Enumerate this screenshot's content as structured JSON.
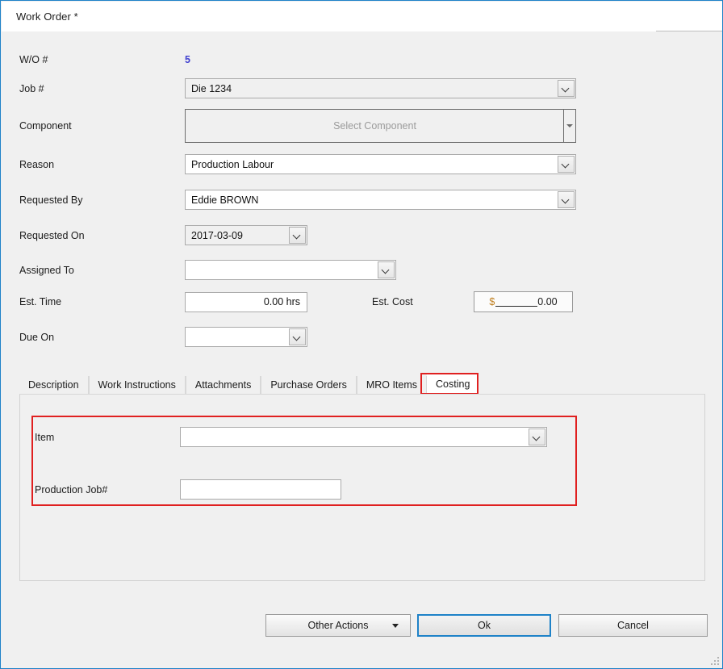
{
  "window": {
    "title": "Work Order *",
    "accent_color": "#1e82c8",
    "highlight_color": "#e02020"
  },
  "form": {
    "fields": [
      {
        "label": "W/O #",
        "type": "static",
        "value": "5"
      },
      {
        "label": "Job #",
        "type": "combo",
        "value": "Die 1234"
      },
      {
        "label": "Component",
        "type": "picker",
        "value": "",
        "placeholder": "Select Component"
      },
      {
        "label": "Reason",
        "type": "combo",
        "value": "Production Labour"
      },
      {
        "label": "Requested By",
        "type": "combo",
        "value": "Eddie BROWN"
      },
      {
        "label": "Requested On",
        "type": "datecombo",
        "value": "2017-03-09"
      },
      {
        "label": "Assigned To",
        "type": "combo",
        "value": ""
      },
      {
        "label": "Est. Time",
        "type": "textbox",
        "value": "0.00 hrs"
      },
      {
        "label": "Due On",
        "type": "datecombo",
        "value": ""
      }
    ],
    "est_cost": {
      "label": "Est. Cost",
      "currency_symbol": "$",
      "mask": "_______",
      "value": "0.00"
    }
  },
  "tabs": {
    "items": [
      {
        "label": "Description",
        "active": false
      },
      {
        "label": "Work Instructions",
        "active": false
      },
      {
        "label": "Attachments",
        "active": false
      },
      {
        "label": "Purchase Orders",
        "active": false
      },
      {
        "label": "MRO Items",
        "active": false
      },
      {
        "label": "Costing",
        "active": true
      }
    ],
    "selected": "Costing"
  },
  "costing_panel": {
    "item": {
      "label": "Item",
      "value": ""
    },
    "production_job": {
      "label": "Production Job#",
      "value": ""
    }
  },
  "footer": {
    "other_actions": "Other Actions",
    "ok": "Ok",
    "cancel": "Cancel"
  }
}
